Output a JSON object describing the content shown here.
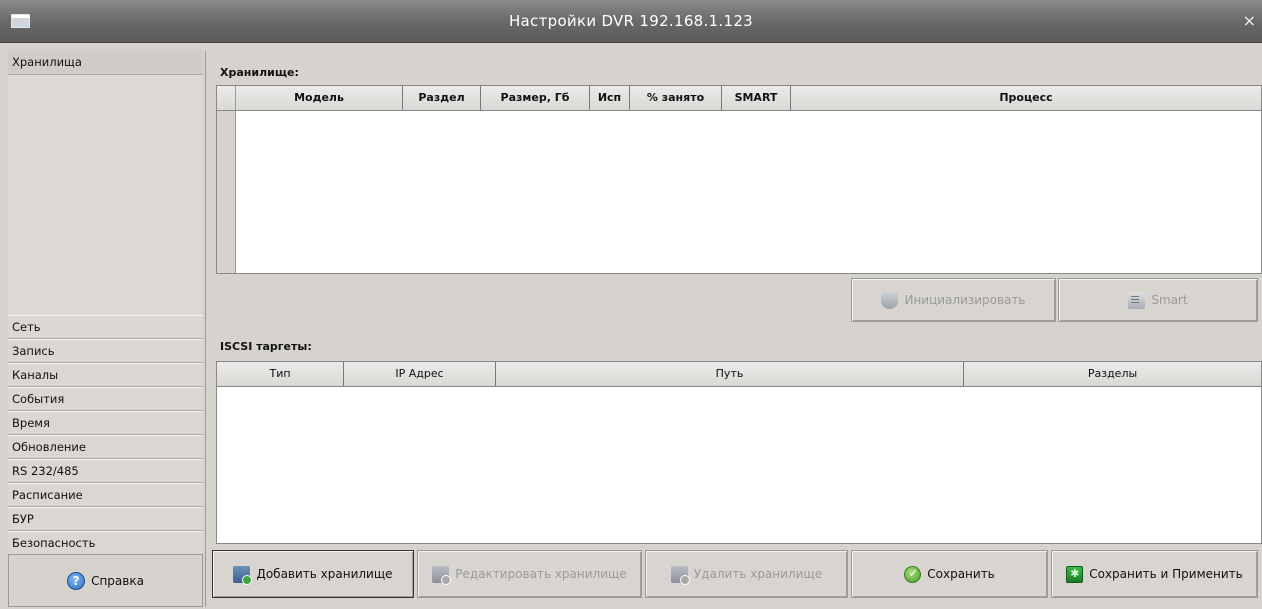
{
  "window": {
    "title": "Настройки DVR 192.168.1.123",
    "close_glyph": "×"
  },
  "sidebar": {
    "items": [
      {
        "label": "Хранилища",
        "active": true
      },
      {
        "label": "Сеть"
      },
      {
        "label": "Запись"
      },
      {
        "label": "Каналы"
      },
      {
        "label": "События"
      },
      {
        "label": "Время"
      },
      {
        "label": "Обновление"
      },
      {
        "label": "RS 232/485"
      },
      {
        "label": "Расписание"
      },
      {
        "label": "БУР"
      },
      {
        "label": "Безопасность"
      }
    ],
    "help_label": "Справка"
  },
  "storage": {
    "section_label": "Хранилище:",
    "columns": [
      "Модель",
      "Раздел",
      "Размер, Гб",
      "Исп",
      "% занято",
      "SMART",
      "Процесс"
    ],
    "rows": [],
    "init_button": "Инициализировать",
    "smart_button": "Smart"
  },
  "iscsi": {
    "section_label": "ISCSI таргеты:",
    "columns": [
      "Тип",
      "IP Адрес",
      "Путь",
      "Разделы"
    ],
    "rows": []
  },
  "buttons": {
    "add_storage": "Добавить хранилище",
    "edit_storage": "Редактировать хранилище",
    "delete_storage": "Удалить хранилище",
    "save": "Сохранить",
    "save_apply": "Сохранить и Применить"
  },
  "icons": {
    "window": "window-icon",
    "help": "help-icon",
    "init": "disk-init-icon",
    "smart": "smart-report-icon",
    "add": "storage-add-icon",
    "edit": "storage-edit-icon",
    "delete": "storage-delete-icon",
    "save": "check-icon",
    "save_apply": "apply-icon"
  }
}
